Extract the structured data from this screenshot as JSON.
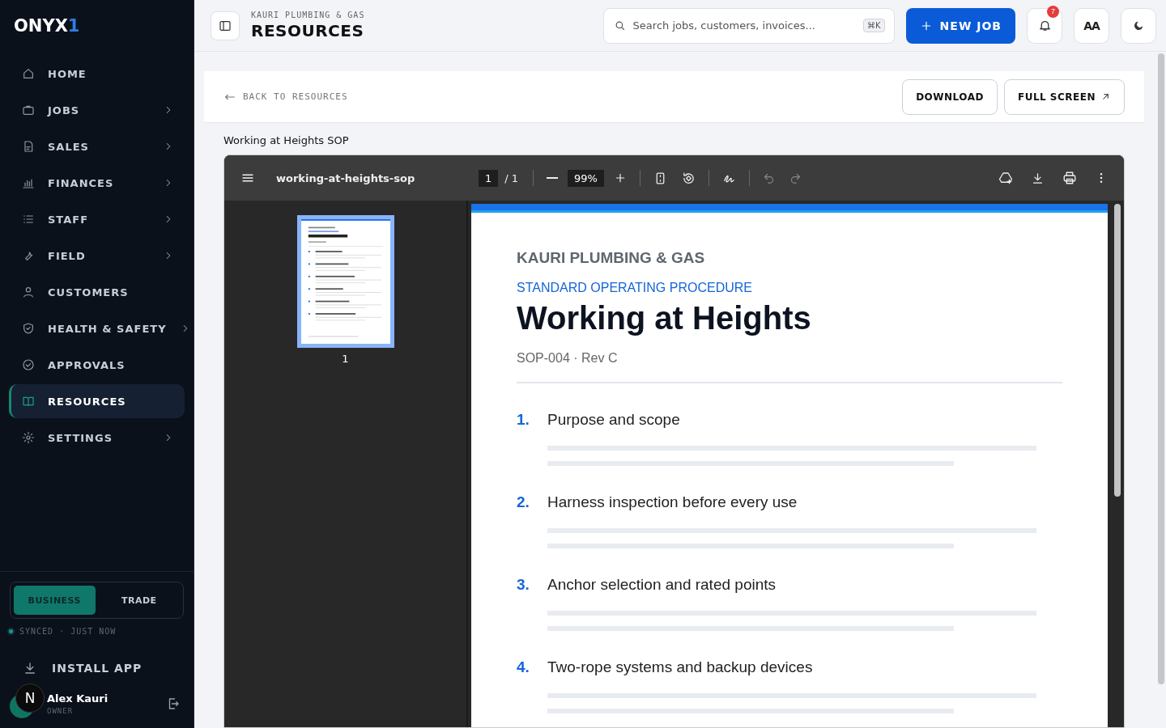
{
  "sidebar": {
    "logo": "ONYX",
    "logo_accent": "1",
    "items": [
      {
        "label": "HOME",
        "has_submenu": false,
        "selected": false
      },
      {
        "label": "JOBS",
        "has_submenu": true,
        "selected": false
      },
      {
        "label": "SALES",
        "has_submenu": true,
        "selected": false
      },
      {
        "label": "FINANCES",
        "has_submenu": true,
        "selected": false
      },
      {
        "label": "STAFF",
        "has_submenu": true,
        "selected": false
      },
      {
        "label": "FIELD",
        "has_submenu": true,
        "selected": false
      },
      {
        "label": "CUSTOMERS",
        "has_submenu": false,
        "selected": false
      },
      {
        "label": "HEALTH & SAFETY",
        "has_submenu": true,
        "selected": false
      },
      {
        "label": "APPROVALS",
        "has_submenu": false,
        "selected": false
      },
      {
        "label": "RESOURCES",
        "has_submenu": false,
        "selected": true
      },
      {
        "label": "SETTINGS",
        "has_submenu": true,
        "selected": false
      }
    ],
    "modes": [
      {
        "label": "BUSINESS",
        "selected": true
      },
      {
        "label": "TRADE",
        "selected": false
      }
    ],
    "sync_status": "SYNCED · JUST NOW",
    "install": "INSTALL APP",
    "dev_badge": "N",
    "user": {
      "name": "Alex Kauri",
      "role": "OWNER"
    }
  },
  "header": {
    "org": "KAURI PLUMBING & GAS",
    "title": "RESOURCES",
    "search": {
      "placeholder": "Search jobs, customers, invoices...",
      "shortcut": "⌘K"
    },
    "new_job": "NEW JOB",
    "notification_count": "7",
    "text_size": "AA"
  },
  "resource": {
    "back": "BACK TO RESOURCES",
    "actions": [
      "DOWNLOAD",
      "FULL SCREEN"
    ],
    "title": "Working at Heights SOP"
  },
  "viewer": {
    "filename": "working-at-heights-sop",
    "page": "1",
    "page_total": "/ 1",
    "zoom": "99%",
    "thumbnails": [
      {
        "label": "1",
        "selected": true
      }
    ],
    "document": {
      "company": "KAURI PLUMBING & GAS",
      "type": "STANDARD OPERATING PROCEDURE",
      "title": "Working at Heights",
      "code": "SOP-004 · Rev C",
      "sections": [
        {
          "number": "1.",
          "title": "Purpose and scope"
        },
        {
          "number": "2.",
          "title": "Harness inspection before every use"
        },
        {
          "number": "3.",
          "title": "Anchor selection and rated points"
        },
        {
          "number": "4.",
          "title": "Two-rope systems and backup devices"
        }
      ]
    }
  }
}
